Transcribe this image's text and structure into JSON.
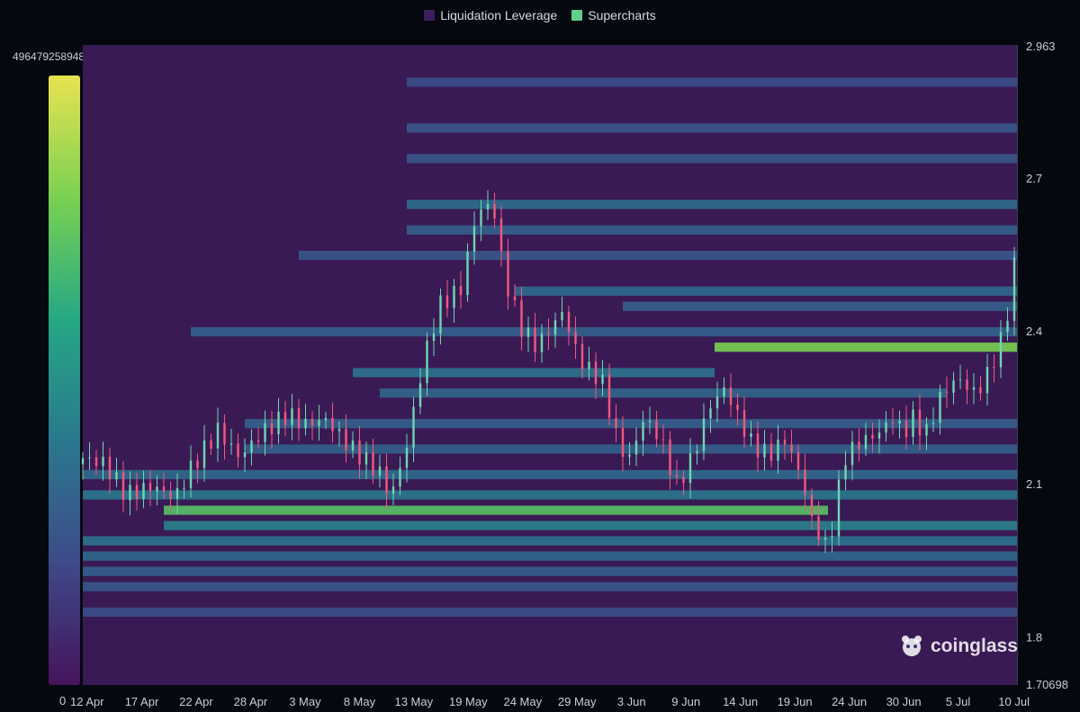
{
  "legend": {
    "items": [
      {
        "label": "Liquidation Leverage",
        "color": "#3b1f5c"
      },
      {
        "label": "Supercharts",
        "color": "#5fd08a"
      }
    ]
  },
  "colorbar": {
    "max_label": "496479258948.00",
    "min_label": "0",
    "colors": [
      "#45145b",
      "#3e4a89",
      "#2a788e",
      "#25a884",
      "#7ad151",
      "#e8e351"
    ]
  },
  "watermark": {
    "text": "coinglass",
    "icon": "coinglass-logo-icon"
  },
  "chart_data": {
    "type": "heatmap",
    "title": "",
    "xlabel": "",
    "ylabel": "",
    "ylim": [
      1.70698,
      2.963
    ],
    "y_ticks": [
      "2.963",
      "2.7",
      "2.4",
      "2.1",
      "1.8",
      "1.70698"
    ],
    "y_tick_values": [
      2.963,
      2.7,
      2.4,
      2.1,
      1.8,
      1.70698
    ],
    "x_ticks": [
      "12 Apr",
      "17 Apr",
      "22 Apr",
      "28 Apr",
      "3 May",
      "8 May",
      "13 May",
      "19 May",
      "24 May",
      "29 May",
      "3 Jun",
      "9 Jun",
      "14 Jun",
      "19 Jun",
      "24 Jun",
      "30 Jun",
      "5 Jul",
      "10 Jul"
    ],
    "price_path": [
      [
        0,
        2.14
      ],
      [
        4,
        2.13
      ],
      [
        8,
        2.07
      ],
      [
        13,
        2.09
      ],
      [
        17,
        2.07
      ],
      [
        20,
        2.13
      ],
      [
        25,
        2.21
      ],
      [
        29,
        2.16
      ],
      [
        33,
        2.21
      ],
      [
        38,
        2.25
      ],
      [
        41,
        2.23
      ],
      [
        45,
        2.24
      ],
      [
        49,
        2.19
      ],
      [
        52,
        2.16
      ],
      [
        55,
        2.13
      ],
      [
        57,
        2.08
      ],
      [
        60,
        2.18
      ],
      [
        63,
        2.34
      ],
      [
        66,
        2.45
      ],
      [
        70,
        2.48
      ],
      [
        73,
        2.63
      ],
      [
        76,
        2.64
      ],
      [
        78,
        2.5
      ],
      [
        81,
        2.4
      ],
      [
        84,
        2.36
      ],
      [
        87,
        2.4
      ],
      [
        89,
        2.43
      ],
      [
        91,
        2.36
      ],
      [
        93,
        2.32
      ],
      [
        96,
        2.3
      ],
      [
        99,
        2.18
      ],
      [
        101,
        2.14
      ],
      [
        104,
        2.23
      ],
      [
        107,
        2.19
      ],
      [
        110,
        2.1
      ],
      [
        113,
        2.16
      ],
      [
        116,
        2.26
      ],
      [
        119,
        2.3
      ],
      [
        121,
        2.25
      ],
      [
        124,
        2.19
      ],
      [
        127,
        2.17
      ],
      [
        130,
        2.2
      ],
      [
        133,
        2.13
      ],
      [
        135,
        2.04
      ],
      [
        138,
        1.98
      ],
      [
        141,
        2.16
      ],
      [
        144,
        2.19
      ],
      [
        147,
        2.2
      ],
      [
        150,
        2.23
      ],
      [
        152,
        2.2
      ],
      [
        154,
        2.23
      ],
      [
        156,
        2.19
      ],
      [
        159,
        2.27
      ],
      [
        162,
        2.3
      ],
      [
        165,
        2.27
      ],
      [
        167,
        2.29
      ],
      [
        170,
        2.37
      ],
      [
        172,
        2.46
      ],
      [
        173,
        2.58
      ]
    ],
    "price_x_span_days": 173,
    "liquidation_bands": [
      {
        "price": 2.05,
        "intensity": 0.72,
        "from_day": 15,
        "to_day": 138
      },
      {
        "price": 2.37,
        "intensity": 0.8,
        "from_day": 117,
        "to_day": 173
      },
      {
        "price": 2.65,
        "intensity": 0.35,
        "from_day": 60,
        "to_day": 173
      },
      {
        "price": 2.6,
        "intensity": 0.3,
        "from_day": 60,
        "to_day": 173
      },
      {
        "price": 2.48,
        "intensity": 0.34,
        "from_day": 80,
        "to_day": 173
      },
      {
        "price": 2.45,
        "intensity": 0.3,
        "from_day": 100,
        "to_day": 173
      },
      {
        "price": 2.32,
        "intensity": 0.38,
        "from_day": 50,
        "to_day": 117
      },
      {
        "price": 2.28,
        "intensity": 0.32,
        "from_day": 55,
        "to_day": 160
      },
      {
        "price": 2.22,
        "intensity": 0.3,
        "from_day": 30,
        "to_day": 173
      },
      {
        "price": 2.17,
        "intensity": 0.3,
        "from_day": 30,
        "to_day": 173
      },
      {
        "price": 2.12,
        "intensity": 0.34,
        "from_day": 0,
        "to_day": 173
      },
      {
        "price": 2.08,
        "intensity": 0.4,
        "from_day": 0,
        "to_day": 173
      },
      {
        "price": 2.02,
        "intensity": 0.44,
        "from_day": 15,
        "to_day": 173
      },
      {
        "price": 1.99,
        "intensity": 0.38,
        "from_day": 0,
        "to_day": 173
      },
      {
        "price": 1.96,
        "intensity": 0.34,
        "from_day": 0,
        "to_day": 173
      },
      {
        "price": 1.93,
        "intensity": 0.3,
        "from_day": 0,
        "to_day": 173
      },
      {
        "price": 1.9,
        "intensity": 0.26,
        "from_day": 0,
        "to_day": 173
      },
      {
        "price": 1.85,
        "intensity": 0.22,
        "from_day": 0,
        "to_day": 173
      },
      {
        "price": 2.89,
        "intensity": 0.22,
        "from_day": 60,
        "to_day": 173
      },
      {
        "price": 2.8,
        "intensity": 0.26,
        "from_day": 60,
        "to_day": 173
      },
      {
        "price": 2.74,
        "intensity": 0.26,
        "from_day": 60,
        "to_day": 173
      },
      {
        "price": 2.55,
        "intensity": 0.26,
        "from_day": 40,
        "to_day": 173
      },
      {
        "price": 2.4,
        "intensity": 0.3,
        "from_day": 20,
        "to_day": 173
      }
    ],
    "grid": false,
    "legend_position": "top-center",
    "colorscale": "viridis"
  }
}
